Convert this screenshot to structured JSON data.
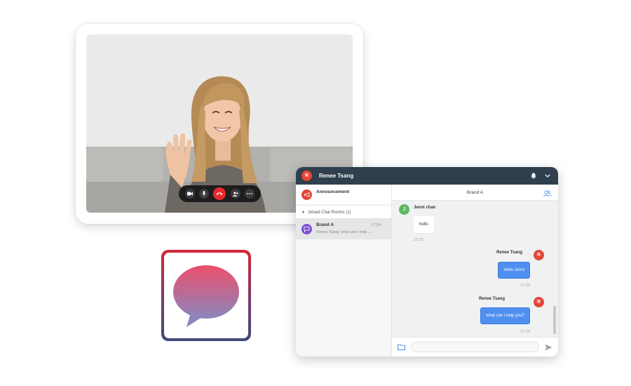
{
  "video_call": {
    "controls": [
      "camera-icon",
      "microphone-icon",
      "end-call-icon",
      "add-person-icon",
      "more-icon"
    ]
  },
  "app_icon": {
    "icon": "chat-bubble-icon",
    "gradient": [
      "#e8516a",
      "#8a7fbb"
    ]
  },
  "chat": {
    "colors": {
      "header_bg": "#2f3f4d",
      "accent": "#4f8ff0",
      "avatar_red": "#e4463a",
      "avatar_green": "#5cb85c",
      "room_purple": "#7b4fd6"
    },
    "header": {
      "user_initial": "R",
      "user_name": "Renee Tsang"
    },
    "sidebar": {
      "announcement_label": "Announcement",
      "rooms_section_label": "Joined Chat Rooms (1)",
      "rooms": [
        {
          "name": "Brand A",
          "preview": "Renee Tsang: what can i help ...",
          "time": "17:24"
        }
      ]
    },
    "main": {
      "room_title": "Brand A",
      "messages": [
        {
          "sender": "Jenni chan",
          "initial": "J",
          "text": "hello",
          "time": "17:23",
          "direction": "in"
        },
        {
          "sender": "Renee Tsang",
          "initial": "R",
          "text": "Hello Jenni",
          "time": "17:23",
          "direction": "out"
        },
        {
          "sender": "Renee Tsang",
          "initial": "R",
          "text": "what can i help you?",
          "time": "17:24",
          "direction": "out"
        }
      ],
      "composer_placeholder": ""
    }
  }
}
